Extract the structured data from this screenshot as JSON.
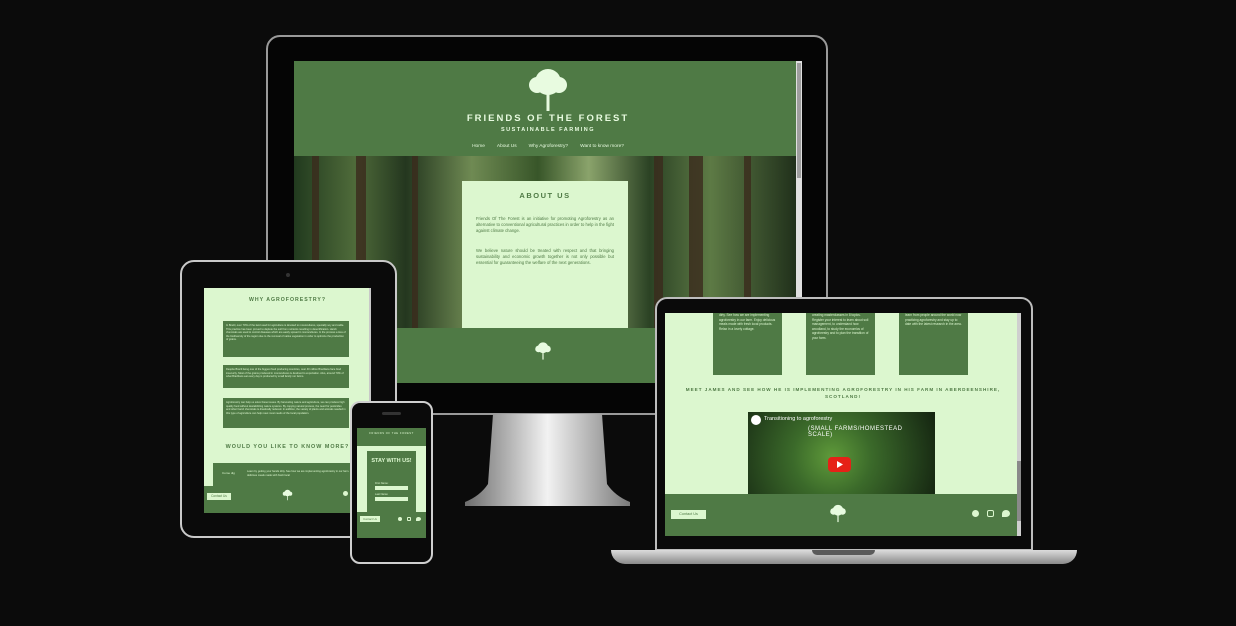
{
  "site": {
    "title": "FRIENDS OF THE FOREST",
    "tagline": "SUSTAINABLE FARMING",
    "nav": [
      "Home",
      "About Us",
      "Why Agroforestry?",
      "Want to know more?"
    ]
  },
  "about": {
    "heading": "ABOUT US",
    "p1": "Friends Of The Forest is an initiative for promoting Agroforestry as an alternative to conventional agricultural practices in order to help in the fight against climate change.",
    "p2": "We believe nature should be treated with respect and that bringing sustainability and economic growth together is not only possible but essential for guaranteeing the welfare of the next generations."
  },
  "tablet": {
    "why_heading": "WHY AGROFORESTRY?",
    "block1": "In Brazil, over 70% of the land used for agriculture is devoted to monocultures, specially soy and cattle. This practice has been proved to deplete the soil from nutrients resulting in desertification. Harsh chemicals are used to control diseases which are easily spread in monocultures. In the process a loss of the biodiversity of the region due to the removal of native vegetation in order to optimize the production of grains.",
    "block2": "Despite Brazil being one of the biggest food producing countries, over 40 million Brazilians face food insecurity. Most of the grains produced in monocultures is destined to exportation. Also, around 70% of what Brazilians eat every day is produced by small family run farms.",
    "block3": "Agroforestry can help us solve these issues. By harvesting nature and agriculture, we can produce high quality food without destabilizing nature systems. By copying natural process, the need for pesticides and other harsh chemicals is drastically reduced. In addition, the variety of plants and animals needed in this type of agriculture can help meet most needs of the local population.",
    "know_heading": "WOULD YOU LIKE TO KNOW MORE?",
    "form_label": "Come dig",
    "form_text": "Learn by getting your hands dirty. See how we are implementing agroforestry in our farm. Enjoy delicious meals made with fresh local",
    "contact": "Contact Us"
  },
  "phone": {
    "top_text": "FRIENDS OF THE FOREST",
    "card_title": "STAY WITH US!",
    "first_name": "First Name:",
    "last_name": "Last Name:",
    "contact": "Contact Us"
  },
  "laptop": {
    "col1": "dirty. See how we are implementing agroforestry in our farm. Enjoy delicious meals made with fresh local products. Relax in a lovely cottage.",
    "col2": "creating masterclasses in 8 topics. Register your interest to learn about soil management, to understand how woodland, to study the economics of agroforestry and to plan the transition of your farm.",
    "col3": "learn from people around the world now practicing agroforestry and stay up to date with the latest research in the area.",
    "meet_heading": "MEET JAMES AND SEE HOW HE IS IMPLEMENTING AGROFORESTRY IN HIS FARM IN ABERDEENSHIRE, SCOTLAND!",
    "video_title": "Transitioning to agroforestry",
    "video_subtitle": "(SMALL FARMS/HOMESTEAD SCALE)",
    "contact": "Contact Us"
  },
  "colors": {
    "green": "#4f7a45",
    "light_green": "#dcf7cf",
    "background": "#0b0b0b"
  }
}
